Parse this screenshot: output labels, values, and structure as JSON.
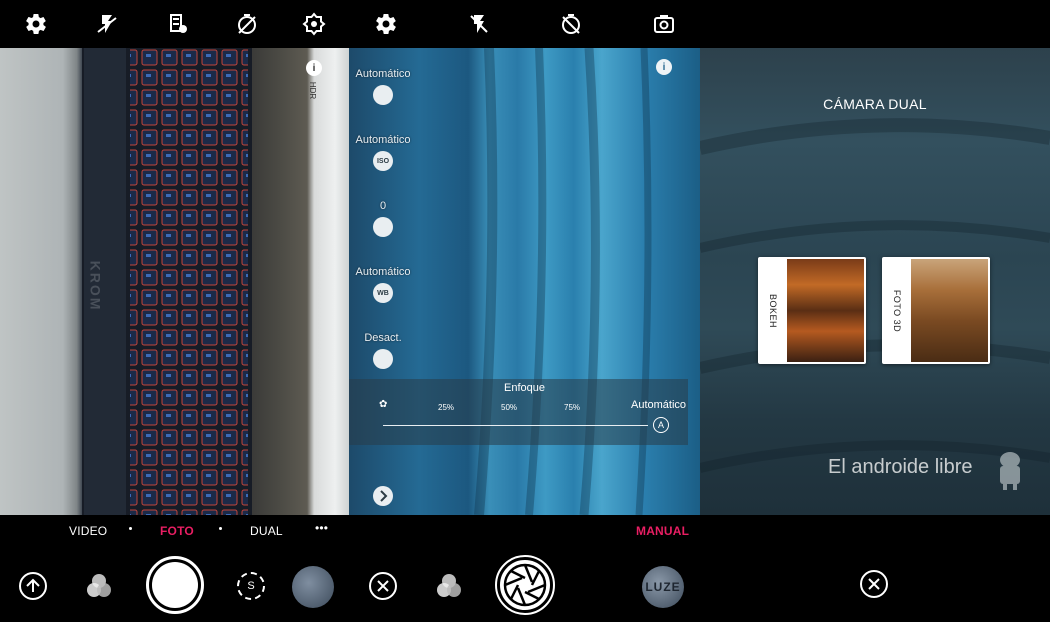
{
  "left_panel": {
    "modes": [
      "VIDEO",
      "FOTO",
      "DUAL"
    ],
    "active_mode": "FOTO",
    "more_label": "•••",
    "hdr_label": "HDR",
    "keyboard_brand": "KROM"
  },
  "middle_panel": {
    "settings": [
      {
        "value": "Automático",
        "icon": "shutter-icon",
        "icon_text": ""
      },
      {
        "value": "Automático",
        "icon": "iso-icon",
        "icon_text": "ISO"
      },
      {
        "value": "0",
        "icon": "exposure-icon",
        "icon_text": ""
      },
      {
        "value": "Automático",
        "icon": "wb-icon",
        "icon_text": "WB"
      },
      {
        "value": "Desact.",
        "icon": "timer-icon",
        "icon_text": ""
      }
    ],
    "focus": {
      "title": "Enfoque",
      "ticks": [
        "25%",
        "50%",
        "75%"
      ],
      "value": "Automático"
    },
    "mode_label": "MANUAL",
    "gallery_text": "LUZE"
  },
  "right_panel": {
    "title": "CÁMARA DUAL",
    "cards": [
      {
        "label": "BOKEH"
      },
      {
        "label": "FOTO 3D"
      }
    ],
    "watermark": "El androide libre"
  },
  "colors": {
    "accent": "#e91e63",
    "bar": "#000000",
    "text": "#ffffff"
  }
}
